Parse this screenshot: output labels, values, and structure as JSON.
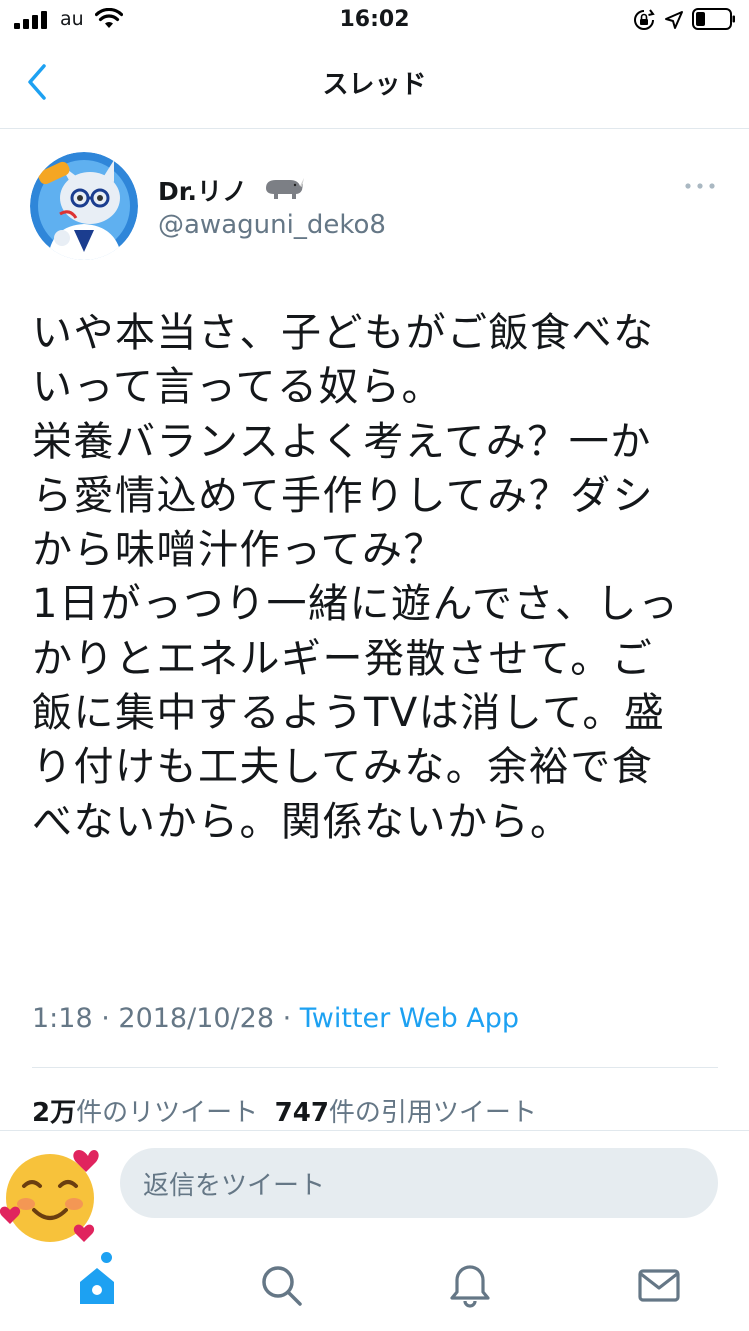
{
  "status_bar": {
    "carrier": "au",
    "time": "16:02",
    "icons": [
      "signal-icon",
      "wifi-icon",
      "orientation-lock-icon",
      "location-icon",
      "battery-icon"
    ]
  },
  "nav": {
    "title": "スレッド",
    "back_icon": "chevron-left-icon"
  },
  "tweet": {
    "display_name": "Dr.リノ",
    "name_emoji": "rhinoceros-emoji",
    "handle": "@awaguni_deko8",
    "text": "いや本当さ、子どもがご飯食べな\nいって言ってる奴ら。\n栄養バランスよく考えてみ？一か\nら愛情込めて手作りしてみ？ダシ\nから味噌汁作ってみ？\n1日がっつり一緒に遊んでさ、しっ\nかりとエネルギー発散させて。ご\n飯に集中するようTVは消して。盛\nり付けも工夫してみな。余裕で食\nべないから。関係ないから。",
    "time": "1:18",
    "date": "2018/10/28",
    "separator": " · ",
    "source": "Twitter Web App",
    "retweets_count": "2万",
    "retweets_label": "件のリツイート",
    "quotes_count": "747",
    "quotes_label": "件の引用ツイート"
  },
  "reply": {
    "placeholder": "返信をツイート",
    "avatar_icon": "smiling-face-with-hearts-emoji"
  },
  "tabs": [
    {
      "name": "home",
      "icon": "home-icon"
    },
    {
      "name": "search",
      "icon": "search-icon"
    },
    {
      "name": "notifications",
      "icon": "bell-icon"
    },
    {
      "name": "messages",
      "icon": "mail-icon"
    }
  ],
  "colors": {
    "accent": "#1da1f2",
    "text": "#14171a",
    "secondary": "#657786",
    "divider": "#e1e8ed",
    "input_bg": "#e6ecf0"
  }
}
